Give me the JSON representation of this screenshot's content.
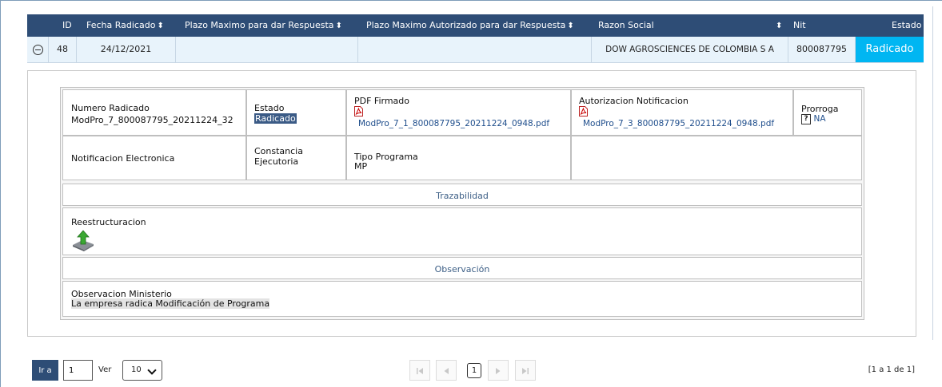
{
  "grid": {
    "headers": {
      "id": "ID",
      "fecha": "Fecha Radicado",
      "plazo_max": "Plazo Maximo para dar Respuesta",
      "plazo_aut": "Plazo Maximo Autorizado para dar Respuesta",
      "razon": "Razon Social",
      "nit": "Nit",
      "estado": "Estado"
    },
    "row": {
      "id": "48",
      "fecha": "24/12/2021",
      "plazo_max": "",
      "plazo_aut": "",
      "razon": "DOW AGROSCIENCES DE COLOMBIA S A",
      "nit": "800087795",
      "estado": "Radicado"
    }
  },
  "detail": {
    "numero_label": "Numero Radicado",
    "numero_value": "ModPro_7_800087795_20211224_32",
    "estado_label": "Estado",
    "estado_value": "Radicado",
    "pdf_label": "PDF Firmado",
    "pdf_link": "ModPro_7_1_800087795_20211224_0948.pdf",
    "aut_label": "Autorizacion Notificacion",
    "aut_link": "ModPro_7_3_800087795_20211224_0948.pdf",
    "prorroga_label": "Prorroga",
    "prorroga_value": "NA",
    "notif_label": "Notificacion Electronica",
    "constancia_label": "Constancia Ejecutoria",
    "tipo_label": "Tipo Programa",
    "tipo_value": "MP",
    "trazabilidad_title": "Trazabilidad",
    "reestructuracion_label": "Reestructuracion",
    "observacion_title": "Observación",
    "obs_label": "Observacion Ministerio",
    "obs_value": "La empresa radica Modificación de Programa"
  },
  "pager": {
    "go_label": "Ir a",
    "page_input": "1",
    "ver_label": "Ver",
    "page_size": "10",
    "current_page": "1",
    "range_text": "[1 a 1 de 1]"
  },
  "colors": {
    "header_bg": "#2e4d76",
    "row_bg": "#e8f3fb",
    "estado_bg": "#00b6f2",
    "link": "#1f4e8c"
  },
  "icons": [
    "collapse-icon",
    "sort-icon",
    "pdf-icon",
    "help-icon",
    "upload-icon",
    "first-page-icon",
    "prev-page-icon",
    "next-page-icon",
    "last-page-icon",
    "chevron-down-icon"
  ]
}
